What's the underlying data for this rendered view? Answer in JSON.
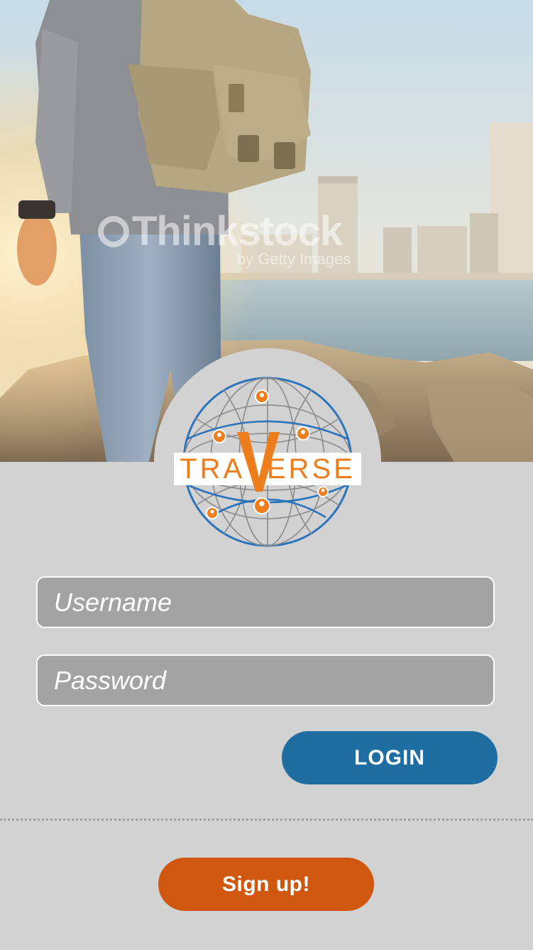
{
  "hero": {
    "watermark_brand": "Thinkstock",
    "watermark_sub": "by Getty Images"
  },
  "logo": {
    "word_left": "TRA",
    "word_mid": "V",
    "word_right": "ERSE",
    "brand_color": "#ee7d1e",
    "globe_color": "#2a74bd"
  },
  "login_form": {
    "username_placeholder": "Username",
    "username_value": "",
    "password_placeholder": "Password",
    "password_value": "",
    "login_label": "LOGIN"
  },
  "signup": {
    "label": "Sign up!"
  },
  "colors": {
    "background": "#d2d2d2",
    "field_bg": "#a3a3a3",
    "login_button": "#1e6ea1",
    "signup_button": "#d0580e"
  }
}
